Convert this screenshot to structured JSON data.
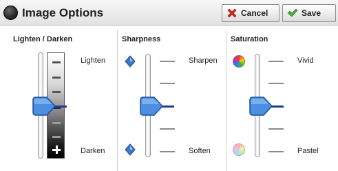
{
  "header": {
    "title": "Image Options",
    "cancel_label": "Cancel",
    "save_label": "Save"
  },
  "lighten_darken": {
    "label": "Lighten / Darken",
    "top_label": "Lighten",
    "bottom_label": "Darken",
    "level": 0.5
  },
  "sharpness": {
    "label": "Sharpness",
    "top_label": "Sharpen",
    "bottom_label": "Soften",
    "level": 0.5
  },
  "saturation": {
    "label": "Saturation",
    "top_label": "Vivid",
    "bottom_label": "Pastel",
    "level": 0.5
  },
  "icons": [
    "sphere-icon",
    "cancel-x-icon",
    "checkmark-icon",
    "diamond-icon",
    "color-wheel-icon",
    "plus-icon",
    "minus-icon"
  ],
  "colors": {
    "accent_blue": "#3a78c8",
    "cancel_red": "#d62a1c",
    "save_green": "#4cae3a"
  }
}
